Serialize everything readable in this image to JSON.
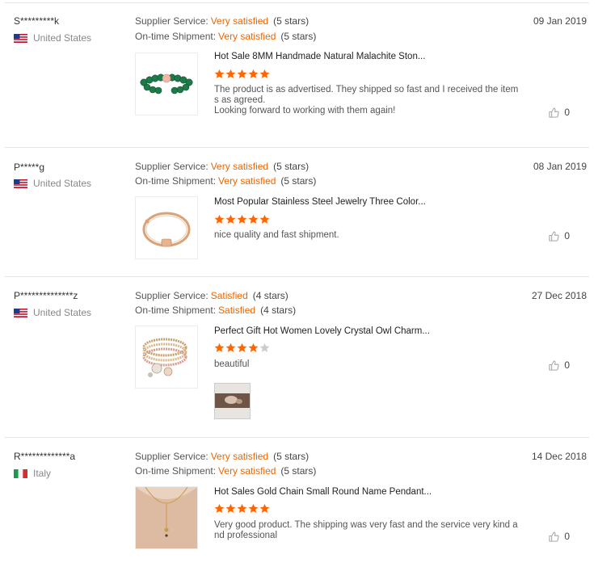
{
  "reviews": [
    {
      "user": "S*********k",
      "country": "United States",
      "flag": "us",
      "supplier_label": "Supplier Service:",
      "supplier_value": "Very satisfied",
      "supplier_count": "(5 stars)",
      "shipment_label": "On-time Shipment:",
      "shipment_value": "Very satisfied",
      "shipment_count": "(5 stars)",
      "date": "09 Jan 2019",
      "product_title": "Hot Sale 8MM Handmade Natural Malachite Ston...",
      "rating": 5,
      "comment_lines": [
        "The product is as advertised. They shipped so fast and I received the item",
        "s as agreed.",
        "Looking forward to working with them again!"
      ],
      "likes": "0",
      "thumb": "malachite-bracelet"
    },
    {
      "user": "P*****g",
      "country": "United States",
      "flag": "us",
      "supplier_label": "Supplier Service:",
      "supplier_value": "Very satisfied",
      "supplier_count": "(5 stars)",
      "shipment_label": "On-time Shipment:",
      "shipment_value": "Very satisfied",
      "shipment_count": "(5 stars)",
      "date": "08 Jan 2019",
      "product_title": "Most Popular Stainless Steel Jewelry Three Color...",
      "rating": 5,
      "comment_lines": [
        "nice quality and fast shipment."
      ],
      "likes": "0",
      "thumb": "gold-bangle"
    },
    {
      "user": "P**************z",
      "country": "United States",
      "flag": "us",
      "supplier_label": "Supplier Service:",
      "supplier_value": "Satisfied",
      "supplier_count": "(4 stars)",
      "shipment_label": "On-time Shipment:",
      "shipment_value": "Satisfied",
      "shipment_count": "(4 stars)",
      "date": "27 Dec 2018",
      "product_title": "Perfect Gift Hot Women Lovely Crystal Owl Charm...",
      "rating": 4,
      "comment_lines": [
        "beautiful"
      ],
      "likes": "0",
      "thumb": "owl-charm-bracelets",
      "has_photo": true
    },
    {
      "user": "R*************a",
      "country": "Italy",
      "flag": "it",
      "supplier_label": "Supplier Service:",
      "supplier_value": "Very satisfied",
      "supplier_count": "(5 stars)",
      "shipment_label": "On-time Shipment:",
      "shipment_value": "Very satisfied",
      "shipment_count": "(5 stars)",
      "date": "14 Dec 2018",
      "product_title": "Hot Sales Gold Chain Small Round Name Pendant...",
      "rating": 5,
      "comment_lines": [
        "Very good product. The shipping was very fast and the service very kind a",
        "nd professional"
      ],
      "likes": "0",
      "thumb": "gold-pendant-necklace"
    }
  ],
  "colors": {
    "accent": "#ee6600",
    "star_on": "#ff6600",
    "star_off": "#cccccc"
  }
}
